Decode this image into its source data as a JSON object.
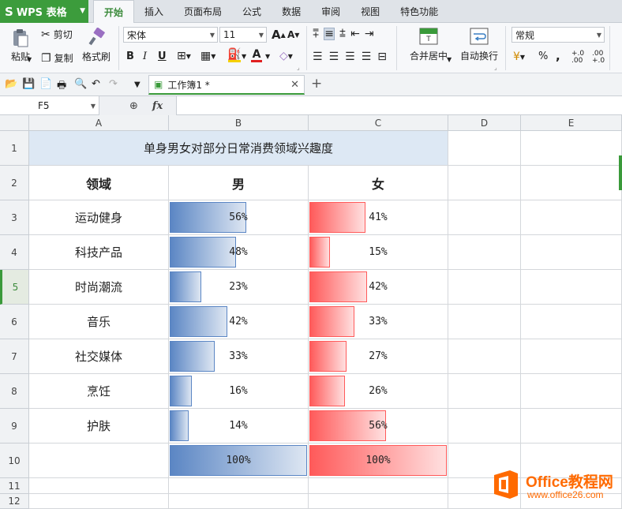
{
  "app": {
    "name": "WPS 表格",
    "logo": "S"
  },
  "ribbon_tabs": [
    "开始",
    "插入",
    "页面布局",
    "公式",
    "数据",
    "审阅",
    "视图",
    "特色功能"
  ],
  "ribbon": {
    "paste": "粘贴",
    "cut": "剪切",
    "copy": "复制",
    "format_painter": "格式刷",
    "font_name": "宋体",
    "font_size": "11",
    "merge_center": "合并居中",
    "wrap_text": "自动换行",
    "number_format": "常规",
    "percent_symbol": "%",
    "comma_symbol": ",",
    "inc_decimal": "+.0\n.00",
    "dec_decimal": ".00\n+.0",
    "bold": "B",
    "italic": "I",
    "underline": "U",
    "font_grow": "A",
    "font_shrink": "A",
    "font_color": "A"
  },
  "doc_tab": {
    "title": "工作簿1 *"
  },
  "formula_bar": {
    "cell_ref": "F5",
    "fx": "fx",
    "value": ""
  },
  "columns": [
    "A",
    "B",
    "C",
    "D",
    "E"
  ],
  "rows": [
    "1",
    "2",
    "3",
    "4",
    "5",
    "6",
    "7",
    "8",
    "9",
    "10",
    "11",
    "12"
  ],
  "selected_row": "5",
  "sheet": {
    "title": "单身男女对部分日常消费领域兴趣度",
    "headers": {
      "field": "领域",
      "male": "男",
      "female": "女"
    },
    "data_rows": [
      {
        "field": "运动健身",
        "male": "56%",
        "female": "41%"
      },
      {
        "field": "科技产品",
        "male": "48%",
        "female": "15%"
      },
      {
        "field": "时尚潮流",
        "male": "23%",
        "female": "42%"
      },
      {
        "field": "音乐",
        "male": "42%",
        "female": "33%"
      },
      {
        "field": "社交媒体",
        "male": "33%",
        "female": "27%"
      },
      {
        "field": "烹饪",
        "male": "16%",
        "female": "26%"
      },
      {
        "field": "护肤",
        "male": "14%",
        "female": "56%"
      }
    ],
    "max_row": {
      "male": "100%",
      "female": "100%"
    }
  },
  "data_bar_levels": {
    "male": [
      0.56,
      0.48,
      0.23,
      0.42,
      0.33,
      0.16,
      0.14,
      1.0
    ],
    "female": [
      0.41,
      0.15,
      0.42,
      0.33,
      0.27,
      0.26,
      0.56,
      1.0
    ]
  },
  "colors": {
    "accent_green": "#3a9a3a",
    "male_bar": "#5b86c4",
    "female_bar": "#ff5a5a",
    "title_fill": "#dde8f4"
  },
  "watermark": {
    "brand": "Office教程网",
    "url": "www.office26.com"
  }
}
